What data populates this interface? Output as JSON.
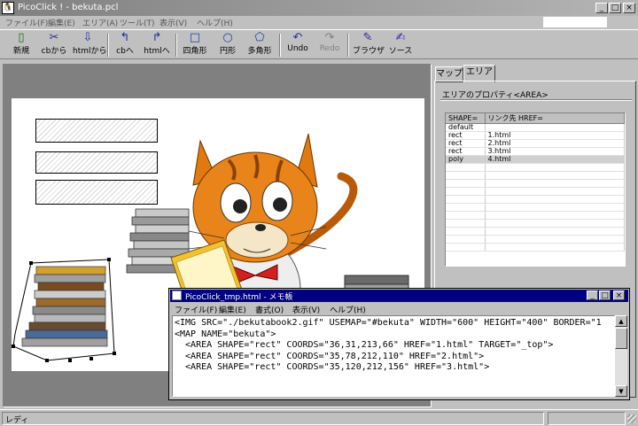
{
  "window": {
    "title": "PicoClick ! - bekuta.pcl",
    "app_icon": "penguin-icon"
  },
  "menubar": [
    "ファイル(F)",
    "編集(E)",
    "エリア(A)",
    "ツール(T)",
    "表示(V)",
    "ヘルプ(H)"
  ],
  "toolbar": {
    "new": "新規",
    "from_cb": "cbから",
    "from_html": "htmlから",
    "to_cb": "cbへ",
    "to_html": "htmlへ",
    "rect": "四角形",
    "circle": "円形",
    "poly": "多角形",
    "undo": "Undo",
    "redo": "Redo",
    "browser": "ブラウザ",
    "source": "ソース"
  },
  "tabs": {
    "map": "マップ",
    "area": "エリア"
  },
  "area_panel": {
    "group_label": "エリアのプロパティ<AREA>",
    "headers": {
      "shape": "SHAPE=",
      "href": "リンク先 HREF="
    },
    "rows": [
      {
        "shape": "default",
        "href": ""
      },
      {
        "shape": "rect",
        "href": "1.html"
      },
      {
        "shape": "rect",
        "href": "2.html"
      },
      {
        "shape": "rect",
        "href": "3.html"
      },
      {
        "shape": "poly",
        "href": "4.html"
      }
    ]
  },
  "notepad": {
    "title": "PicoClick_tmp.html - メモ帳",
    "menu": [
      "ファイル(F)",
      "編集(E)",
      "書式(O)",
      "表示(V)",
      "ヘルプ(H)"
    ],
    "lines": [
      "<IMG SRC=\"./bekutabook2.gif\" USEMAP=\"#bekuta\" WIDTH=\"600\" HEIGHT=\"400\" BORDER=\"1",
      "<MAP NAME=\"bekuta\">",
      "  <AREA SHAPE=\"rect\" COORDS=\"36,31,213,66\" HREF=\"1.html\" TARGET=\"_top\">",
      "  <AREA SHAPE=\"rect\" COORDS=\"35,78,212,110\" HREF=\"2.html\">",
      "  <AREA SHAPE=\"rect\" COORDS=\"35,120,212,156\" HREF=\"3.html\">"
    ]
  },
  "status": {
    "text": "レディ"
  },
  "colors": {
    "cat_orange": "#e07a10",
    "notepad_title": "#000080",
    "selection": "#d0d0d0"
  }
}
